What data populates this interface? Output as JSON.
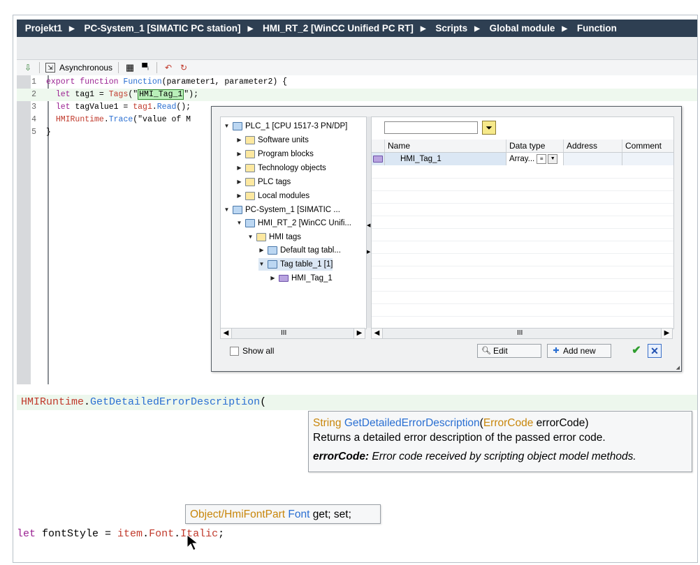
{
  "breadcrumb": [
    "Projekt1",
    "PC-System_1 [SIMATIC PC station]",
    "HMI_RT_2 [WinCC Unified PC RT]",
    "Scripts",
    "Global module",
    "Function"
  ],
  "toolbar": {
    "async_label": "Asynchronous"
  },
  "code": {
    "lines": [
      {
        "n": "1"
      },
      {
        "n": "2"
      },
      {
        "n": "3"
      },
      {
        "n": "4"
      },
      {
        "n": "5"
      }
    ],
    "l1": {
      "kw": "export function ",
      "fn": "Function",
      "rest": "(parameter1, parameter2) {"
    },
    "l2": {
      "kw": "let ",
      "a": "tag1 = ",
      "obj": "Tags",
      "b": "(\"",
      "hl": "HMI_Tag_1",
      "c": "\");"
    },
    "l3": {
      "kw": "let ",
      "a": "tagValue1 = ",
      "obj": "tag1",
      "b": ".",
      "fn": "Read",
      "c": "();"
    },
    "l4": {
      "obj": "HMIRuntime",
      "b": ".",
      "fn": "Trace",
      "c": "(\"value of M"
    },
    "l5": {
      "a": "}"
    }
  },
  "dialog": {
    "tree": [
      {
        "label": "PLC_1 [CPU 1517-3 PN/DP]",
        "expand": "▼"
      },
      {
        "label": "Software units",
        "expand": "▶"
      },
      {
        "label": "Program blocks",
        "expand": "▶"
      },
      {
        "label": "Technology objects",
        "expand": "▶"
      },
      {
        "label": "PLC tags",
        "expand": "▶"
      },
      {
        "label": "Local modules",
        "expand": "▶"
      },
      {
        "label": "PC-System_1 [SIMATIC ...",
        "expand": "▼"
      },
      {
        "label": "HMI_RT_2 [WinCC Unifi...",
        "expand": "▼"
      },
      {
        "label": "HMI tags",
        "expand": "▼"
      },
      {
        "label": "Default tag tabl...",
        "expand": "▶"
      },
      {
        "label": "Tag table_1 [1]",
        "expand": "▼"
      },
      {
        "label": "HMI_Tag_1",
        "expand": "▶"
      }
    ],
    "grid": {
      "columns": [
        "Name",
        "Data type",
        "Address",
        "Comment"
      ],
      "row": {
        "name": "HMI_Tag_1",
        "type": "Array..."
      }
    },
    "scroll_thumb": "III",
    "show_all": "Show all",
    "edit": "Edit",
    "add_new": "Add new"
  },
  "example1": {
    "obj": "HMIRuntime",
    "dot": ".",
    "fn": "GetDetailedErrorDescription",
    "paren": "("
  },
  "tooltip1": {
    "ret_type": "String",
    "fn": "GetDetailedErrorDescription",
    "open": "(",
    "param_type": "ErrorCode",
    "param": " errorCode",
    "close": ")",
    "desc": "Returns a detailed error description of the passed error code.",
    "param_name": "errorCode:",
    "param_desc": " Error code received by scripting object model methods."
  },
  "tooltip2": {
    "type": "Object/HmiFontPart",
    "prop": "Font",
    "access": " get; set;"
  },
  "example3": {
    "kw": "let",
    "a": " fontStyle = ",
    "obj": "item",
    "b": ".",
    "fn": "Font",
    "c": ".",
    "obj2": "Italic",
    "d": ";"
  }
}
